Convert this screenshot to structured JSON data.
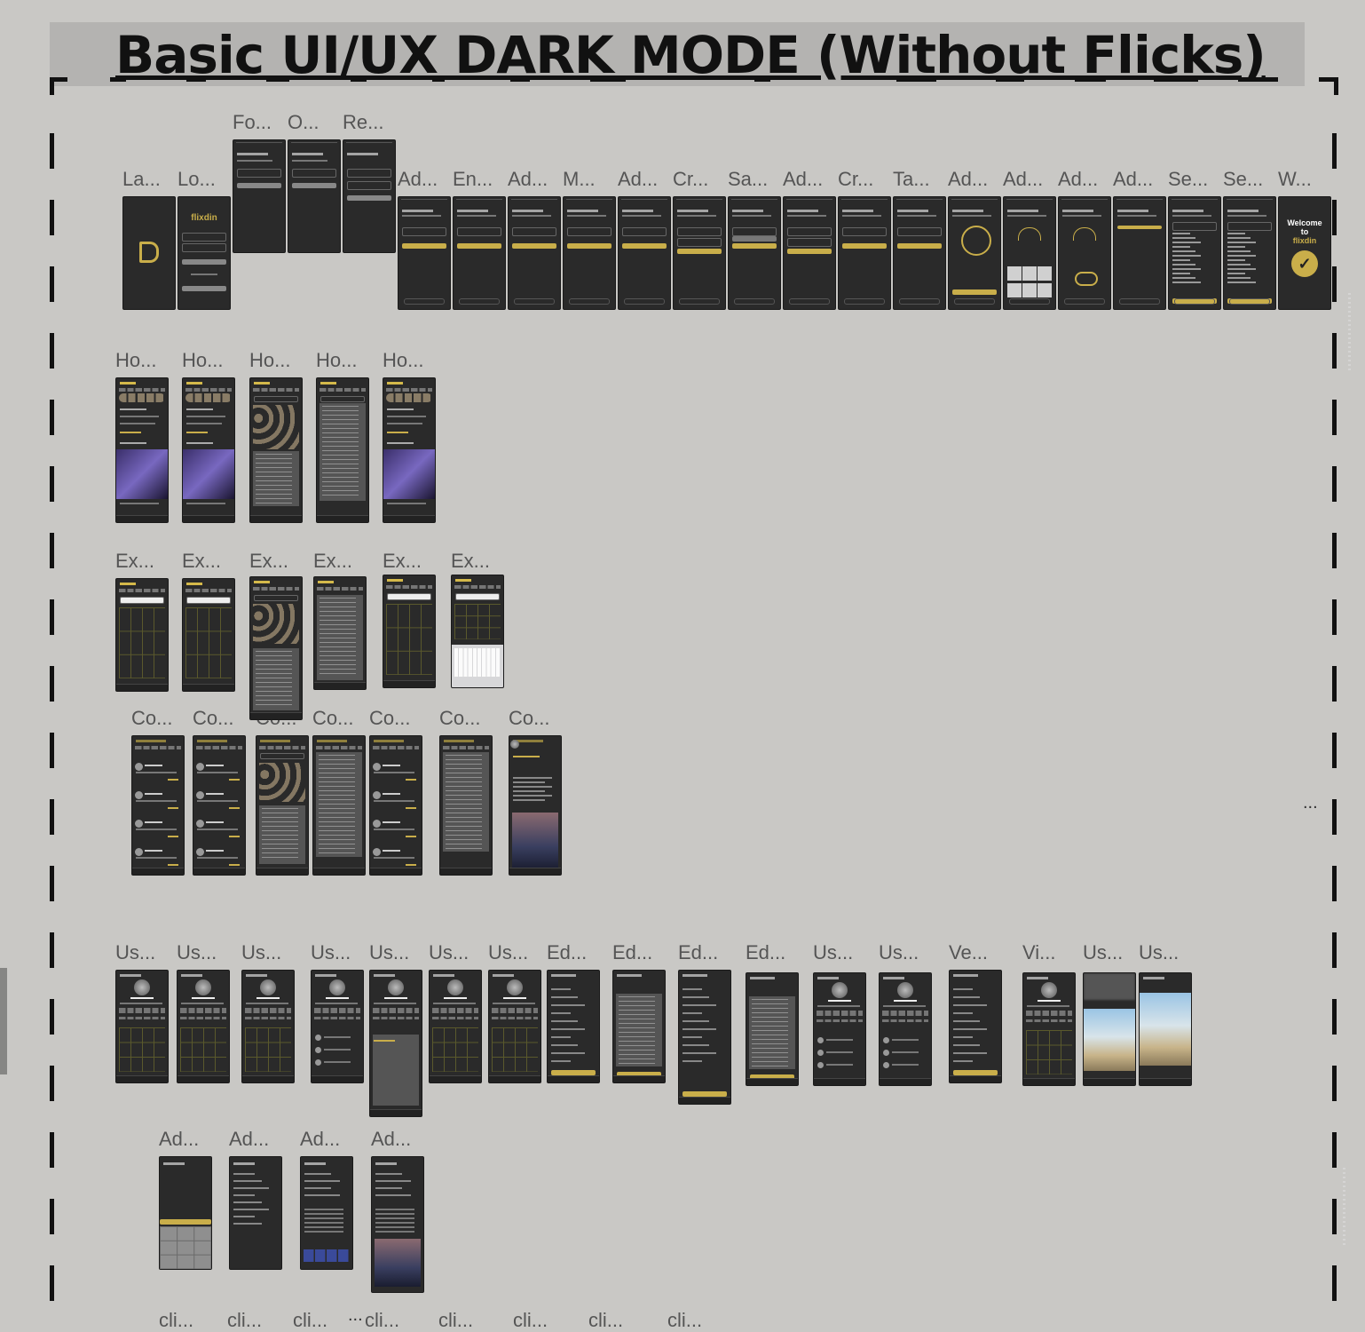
{
  "canvas": {
    "title": "Basic UI/UX DARK MODE (Without Flicks)",
    "ellipsis": "...",
    "brand": "flixdin",
    "welcome_line1": "Welcome",
    "welcome_line2": "to",
    "welcome_brand": "flixdin"
  },
  "row0": [
    "Fo...",
    "O...",
    "Re..."
  ],
  "row1": [
    "La...",
    "Lo...",
    "Ad...",
    "En...",
    "Ad...",
    "M...",
    "Ad...",
    "Cr...",
    "Sa...",
    "Ad...",
    "Cr...",
    "Ta...",
    "Ad...",
    "Ad...",
    "Ad...",
    "Ad...",
    "Se...",
    "Se...",
    "W..."
  ],
  "row2": [
    "Ho...",
    "Ho...",
    "Ho...",
    "Ho...",
    "Ho..."
  ],
  "row3": [
    "Ex...",
    "Ex...",
    "Ex...",
    "Ex...",
    "Ex...",
    "Ex..."
  ],
  "row4": [
    "Co...",
    "Co...",
    "Co...",
    "Co...",
    "Co...",
    "Co...",
    "Co..."
  ],
  "row5": [
    "Us...",
    "Us...",
    "Us...",
    "Us...",
    "Us...",
    "Us...",
    "Us...",
    "Ed...",
    "Ed...",
    "Ed...",
    "Ed...",
    "Us...",
    "Us...",
    "Ve...",
    "Vi...",
    "Us...",
    "Us..."
  ],
  "row6": [
    "Ad...",
    "Ad...",
    "Ad...",
    "Ad..."
  ],
  "row7": [
    "cli...",
    "cli...",
    "cli...",
    "cli...",
    "cli...",
    "cli...",
    "cli...",
    "cli..."
  ]
}
